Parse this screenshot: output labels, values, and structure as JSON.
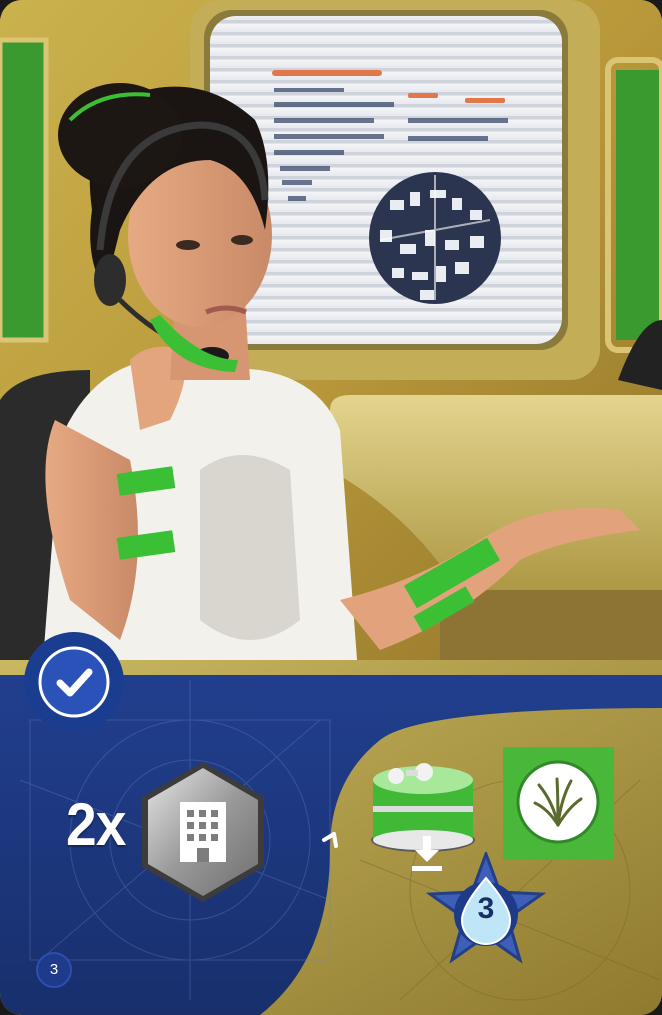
{
  "card": {
    "multiplier": "2x",
    "water_value": "3",
    "page_number": "3"
  },
  "icons": {
    "completed": "checkmark-icon",
    "requirement": "building-icon",
    "arrow": "chevron-right-icon",
    "greenery": "dome-icon",
    "plant": "plant-icon",
    "place": "down-arrow-icon",
    "ocean": "water-drop-icon"
  },
  "colors": {
    "panel_blue": "#1b3d8f",
    "panel_gold": "#b8a44a",
    "accent_green": "#3fbf3a",
    "tile_green": "#49b83a"
  }
}
